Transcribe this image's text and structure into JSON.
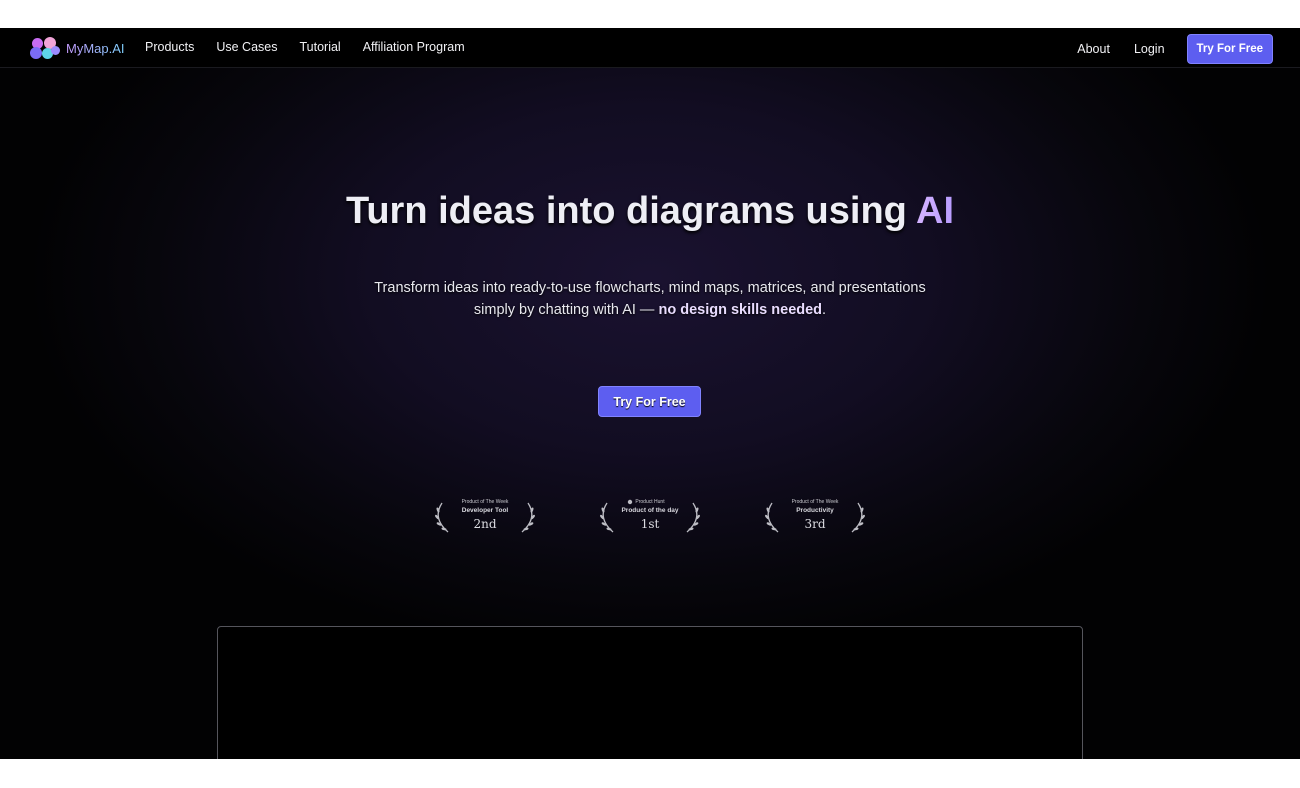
{
  "brand": {
    "name": "MyMap.AI"
  },
  "nav": {
    "links": [
      "Products",
      "Use Cases",
      "Tutorial",
      "Affiliation Program"
    ],
    "about": "About",
    "login": "Login",
    "cta": "Try For Free"
  },
  "hero": {
    "title_main": "Turn ideas into diagrams using ",
    "title_accent": "AI",
    "subtitle_part1": "Transform ideas into ready-to-use flowcharts, mind maps, matrices, and presentations simply by chatting with AI — ",
    "subtitle_bold": "no design skills needed",
    "subtitle_end": ".",
    "cta": "Try For Free"
  },
  "badges": [
    {
      "top": "Product of The Week",
      "title": "Developer Tool",
      "rank": "2nd"
    },
    {
      "top": "Product Hunt",
      "title": "Product of the day",
      "rank": "1st"
    },
    {
      "top": "Product of The Week",
      "title": "Productivity",
      "rank": "3rd"
    }
  ],
  "colors": {
    "accent": "#5d5ef0",
    "background": "#000000",
    "title_accent": "#d5b4ff"
  }
}
